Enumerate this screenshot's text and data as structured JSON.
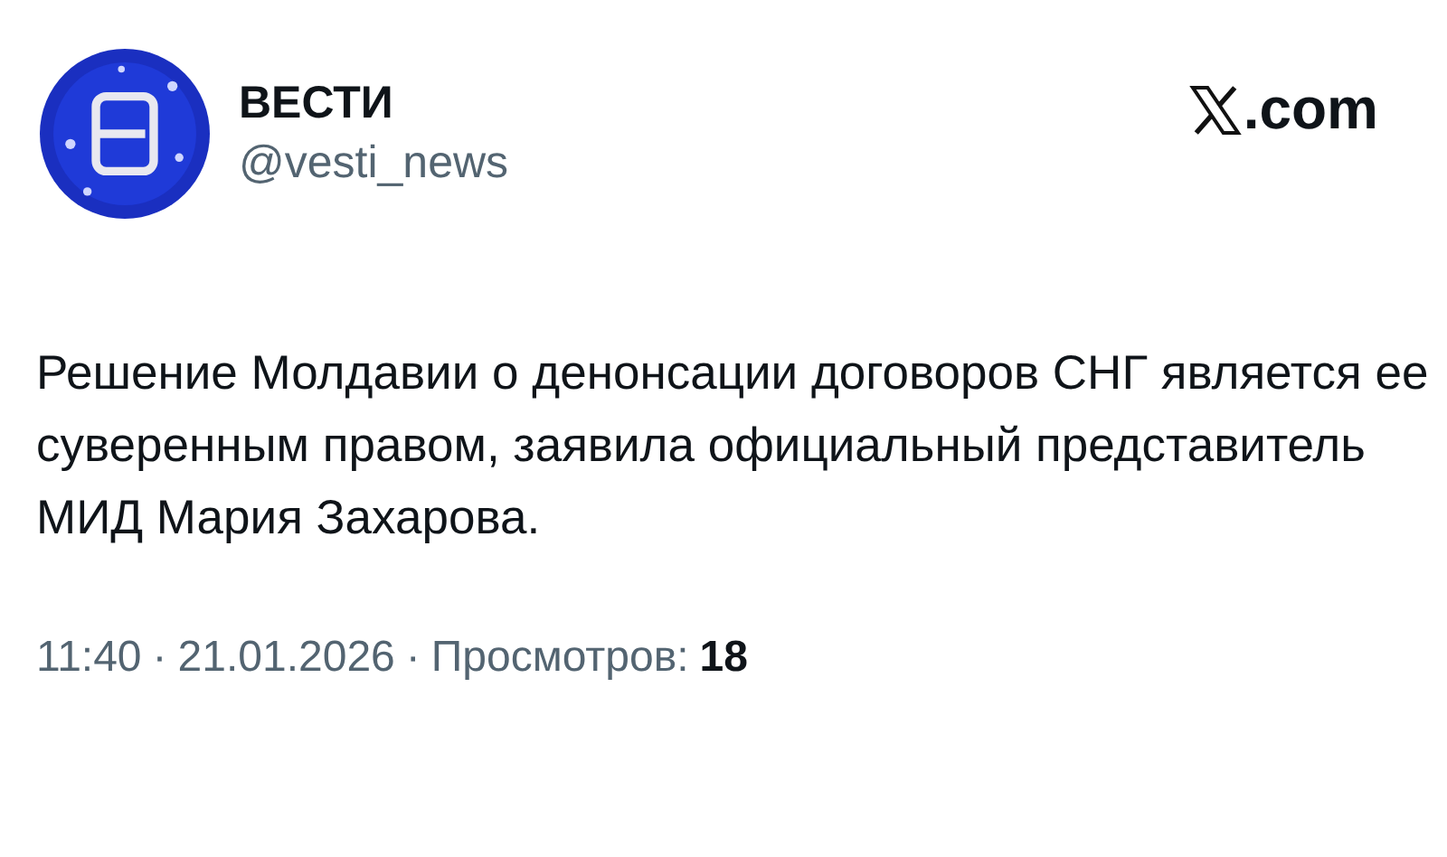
{
  "author": {
    "name": "ВЕСТИ",
    "handle": "@vesti_news"
  },
  "site": {
    "suffix": ".com"
  },
  "tweet": {
    "text": "Решение Молдавии о денонсации договоров СНГ является ее суверенным правом, заявила официальный представитель МИД Мария Захарова."
  },
  "footer": {
    "time": "11:40",
    "separator": "·",
    "date": "21.01.2026",
    "views_label": "Просмотров:",
    "views_count": "18"
  }
}
